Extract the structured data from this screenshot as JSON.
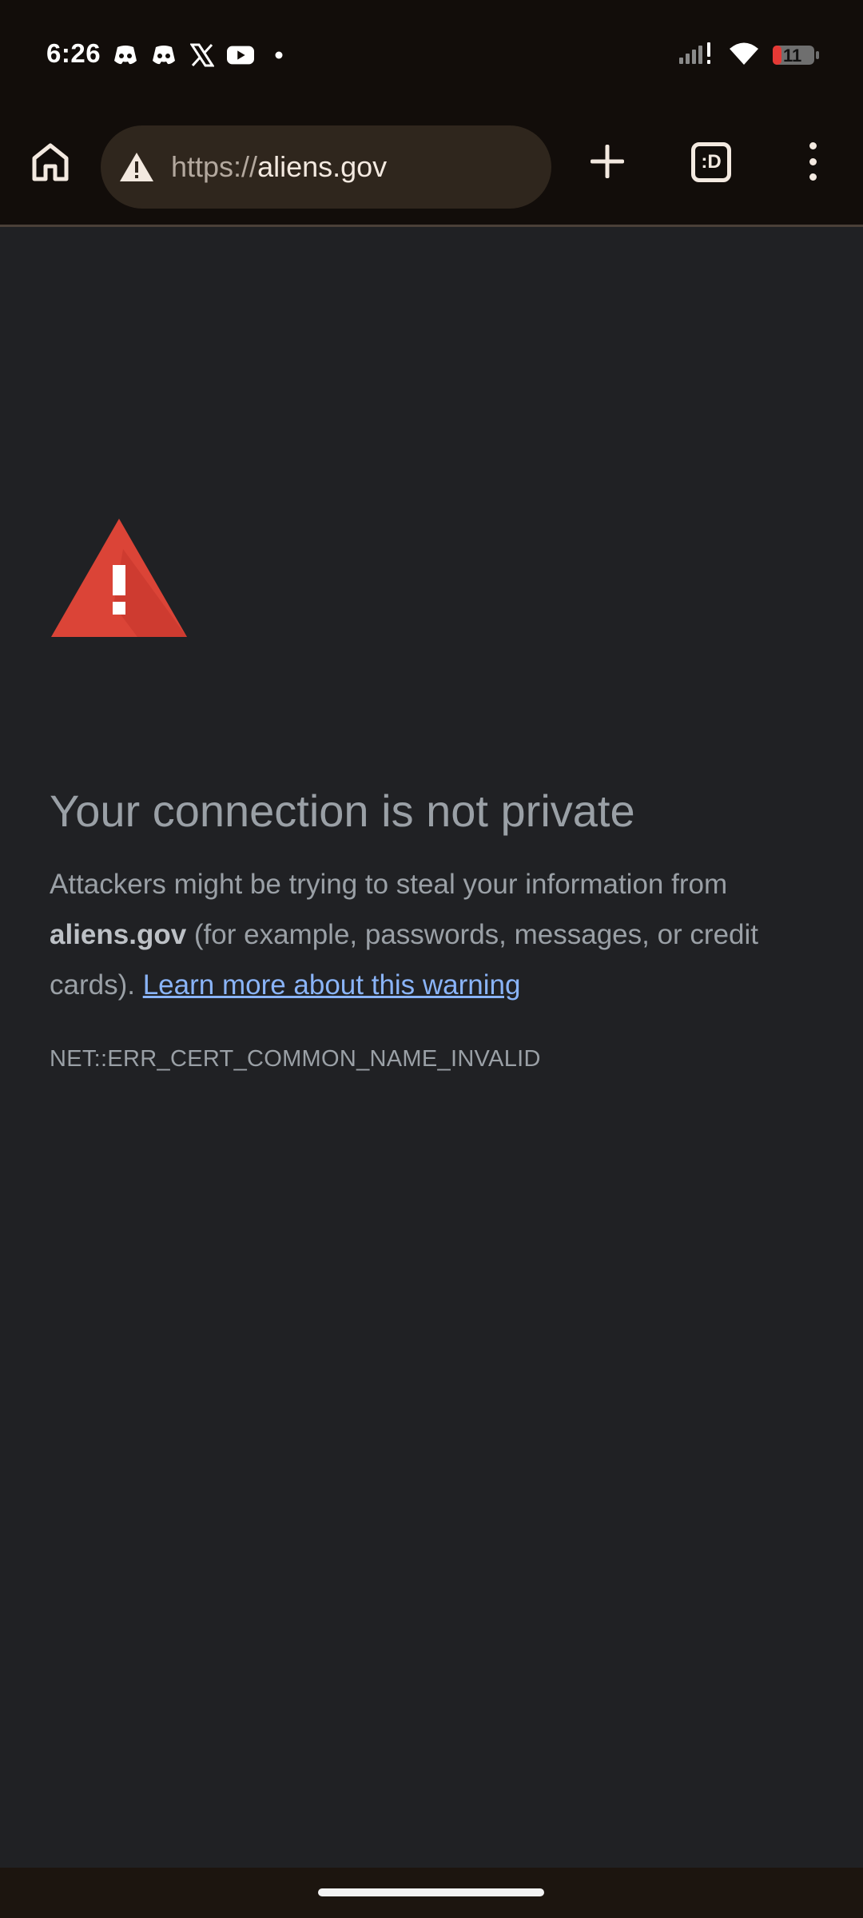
{
  "status_bar": {
    "time": "6:26",
    "notification_icons": [
      "discord-icon",
      "discord-icon",
      "x-icon",
      "youtube-icon",
      "dot-icon"
    ],
    "right_icons": [
      "signal-icon",
      "wifi-icon",
      "battery-icon"
    ],
    "battery_level": "11",
    "battery_color": "#e53935"
  },
  "toolbar": {
    "url_scheme": "https://",
    "url_host": "aliens.gov",
    "tabs_label": ":D"
  },
  "page": {
    "heading": "Your connection is not private",
    "explanation_prefix": "Attackers might be trying to steal your information from ",
    "explanation_host": "aliens.gov",
    "explanation_suffix": " (for example, passwords, messages, or credit cards). ",
    "learn_more": "Learn more about this warning",
    "error_code": "NET::ERR_CERT_COMMON_NAME_INVALID"
  },
  "colors": {
    "background": "#202124",
    "toolbar": "#120d0a",
    "warning_red": "#db4437",
    "link": "#8ab4f8",
    "text": "#9aa0a6"
  }
}
